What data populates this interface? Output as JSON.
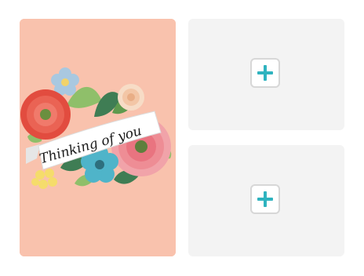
{
  "card": {
    "greeting": "Thinking of you",
    "background_color": "#f9c2ad"
  },
  "slots": [
    {
      "button_icon": "plus-icon",
      "accent": "#2fb3bf"
    },
    {
      "button_icon": "plus-icon",
      "accent": "#2fb3bf"
    }
  ]
}
